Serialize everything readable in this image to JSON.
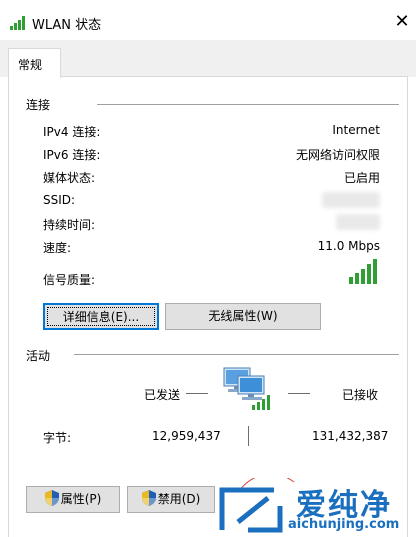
{
  "window": {
    "title": "WLAN 状态",
    "close_glyph": "✕"
  },
  "tabs": [
    {
      "label": "常规",
      "selected": true
    }
  ],
  "connection": {
    "section_title": "连接",
    "rows": [
      {
        "label": "IPv4 连接:",
        "value": "Internet"
      },
      {
        "label": "IPv6 连接:",
        "value": "无网络访问权限"
      },
      {
        "label": "媒体状态:",
        "value": "已启用"
      },
      {
        "label": "SSID:",
        "value": ""
      },
      {
        "label": "持续时间:",
        "value": ""
      },
      {
        "label": "速度:",
        "value": "11.0 Mbps"
      },
      {
        "label": "信号质量:",
        "value": ""
      }
    ],
    "details_button": "详细信息(E)...",
    "wireless_props_button": "无线属性(W)"
  },
  "activity": {
    "section_title": "活动",
    "sent_label": "已发送",
    "received_label": "已接收",
    "bytes_label": "字节:",
    "bytes_sent": "12,959,437",
    "bytes_received": "131,432,387",
    "signal_bars": 4
  },
  "footer": {
    "properties_button": "属性(P)",
    "disable_button": "禁用(D)"
  },
  "watermark": {
    "name": "爱纯净",
    "url": "aichunjing.com"
  },
  "colors": {
    "signal_green": "#2e9e35",
    "focus_blue": "#0078d7",
    "watermark_blue": "#1a6fbf"
  }
}
